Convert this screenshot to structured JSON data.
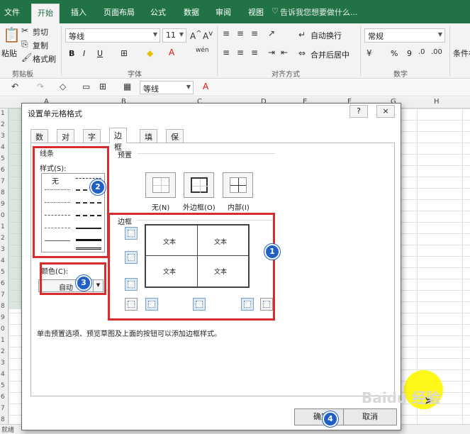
{
  "ribbon": {
    "tabs": [
      "文件",
      "开始",
      "插入",
      "页面布局",
      "公式",
      "数据",
      "审阅",
      "视图"
    ],
    "active_tab": "开始",
    "tell_me": "告诉我您想要做什么...",
    "clipboard": {
      "paste": "粘贴",
      "cut": "剪切",
      "copy": "复制",
      "format_painter": "格式刷",
      "group": "剪贴板"
    },
    "font": {
      "name": "等线",
      "size": "11",
      "bold": "B",
      "italic": "I",
      "underline": "U",
      "group": "字体"
    },
    "alignment": {
      "wrap": "自动换行",
      "merge": "合并后居中",
      "group": "对齐方式"
    },
    "number": {
      "format": "常规",
      "percent": "%",
      "comma": "9",
      "group": "数字"
    },
    "conditional": "条件格"
  },
  "qat": {
    "font": "等线"
  },
  "sheet": {
    "columns": [
      "A",
      "B",
      "C",
      "D",
      "E",
      "F",
      "G",
      "H"
    ],
    "rows": [
      "1",
      "2",
      "3",
      "4",
      "5",
      "6",
      "7",
      "8",
      "9",
      "0",
      "1",
      "2",
      "3",
      "4",
      "5",
      "6",
      "7",
      "8",
      "9",
      "0",
      "1",
      "2",
      "3",
      "4",
      "5",
      "6",
      "7",
      "8"
    ],
    "status": "就绪"
  },
  "dialog": {
    "title": "设置单元格格式",
    "help": "?",
    "close": "×",
    "tabs": [
      "数字",
      "对齐",
      "字体",
      "边框",
      "填充",
      "保护"
    ],
    "active_tab": "边框",
    "line_section": "线条",
    "style_label": "样式(S):",
    "none_style": "无",
    "color_label": "颜色(C):",
    "color_value": "自动",
    "presets_label": "预置",
    "presets": [
      "无(N)",
      "外边框(O)",
      "内部(I)"
    ],
    "border_label": "边框",
    "preview_text": [
      "文本",
      "文本",
      "文本",
      "文本"
    ],
    "hint": "单击预置选项、预览草图及上面的按钮可以添加边框样式。",
    "ok": "确定",
    "cancel": "取消"
  },
  "markers": [
    "1",
    "2",
    "3",
    "4"
  ],
  "watermark": "Baidu 经验"
}
